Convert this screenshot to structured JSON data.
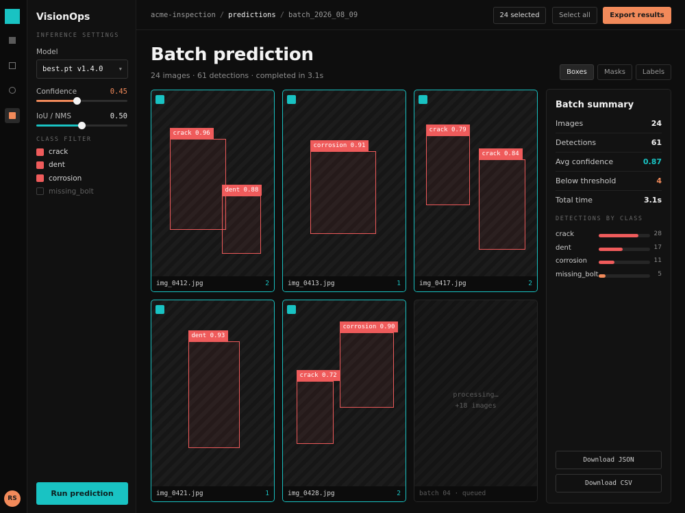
{
  "app": {
    "name": "VisionOps",
    "user_initials": "RS"
  },
  "rail": {
    "items": [
      "dashboard-icon",
      "datasets-icon",
      "models-icon",
      "predictions-icon"
    ]
  },
  "settings": {
    "section_label": "INFERENCE SETTINGS",
    "model_label": "Model",
    "model_value": "best.pt v1.4.0",
    "confidence_label": "Confidence",
    "confidence_value": "0.45",
    "confidence": 0.45,
    "iou_label": "IoU / NMS",
    "iou_value": "0.50",
    "iou": 0.5,
    "class_filter_label": "CLASS FILTER",
    "classes": [
      {
        "name": "crack",
        "checked": true
      },
      {
        "name": "dent",
        "checked": true
      },
      {
        "name": "corrosion",
        "checked": true
      },
      {
        "name": "missing_bolt",
        "checked": false
      }
    ],
    "run_label": "Run prediction"
  },
  "topbar": {
    "breadcrumb": [
      "acme-inspection",
      "predictions",
      "batch_2026_08_09"
    ],
    "selected_label": "24 selected",
    "select_all_label": "Select all",
    "export_label": "Export results"
  },
  "page": {
    "title": "Batch prediction",
    "subtitle": "24 images · 61 detections · completed in 3.1s",
    "view_modes": [
      "Boxes",
      "Masks",
      "Labels"
    ],
    "active_view": "Boxes"
  },
  "images": [
    {
      "file": "img_0412.jpg",
      "count": "2",
      "detections": [
        "crack 0.96",
        "dent 0.88"
      ]
    },
    {
      "file": "img_0413.jpg",
      "count": "1",
      "detections": [
        "corrosion 0.91"
      ]
    },
    {
      "file": "img_0417.jpg",
      "count": "2",
      "detections": [
        "crack 0.79",
        "crack 0.84"
      ]
    },
    {
      "file": "img_0421.jpg",
      "count": "1",
      "detections": [
        "dent 0.93"
      ]
    },
    {
      "file": "img_0428.jpg",
      "count": "2",
      "detections": [
        "corrosion 0.90",
        "crack 0.72"
      ]
    }
  ],
  "pending": {
    "line1": "processing…",
    "line2": "+18 images",
    "footer": "batch 04 · queued"
  },
  "summary": {
    "title": "Batch summary",
    "rows": [
      {
        "label": "Images",
        "value": "24"
      },
      {
        "label": "Detections",
        "value": "61"
      },
      {
        "label": "Avg confidence",
        "value": "0.87"
      },
      {
        "label": "Below threshold",
        "value": "4"
      },
      {
        "label": "Total time",
        "value": "3.1s"
      }
    ],
    "by_class_label": "DETECTIONS BY CLASS",
    "by_class": [
      {
        "name": "crack",
        "count": "28",
        "value": 28
      },
      {
        "name": "dent",
        "count": "17",
        "value": 17
      },
      {
        "name": "corrosion",
        "count": "11",
        "value": 11
      },
      {
        "name": "missing_bolt",
        "count": "5",
        "value": 5
      }
    ],
    "download_json": "Download JSON",
    "download_csv": "Download CSV"
  },
  "colors": {
    "accent": "#19c3c3",
    "warning": "#f28a5a",
    "detection": "#ef5b5b"
  }
}
